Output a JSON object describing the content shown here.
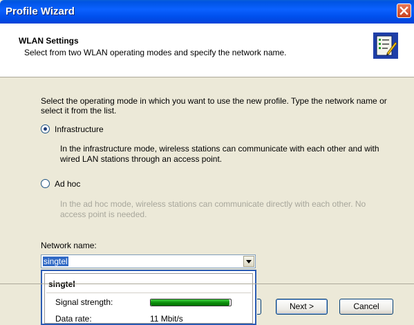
{
  "window": {
    "title": "Profile Wizard",
    "close_icon": "close-icon"
  },
  "header": {
    "title": "WLAN Settings",
    "subtitle": "Select from two WLAN operating modes and specify the network name.",
    "icon": "wizard-checklist-icon"
  },
  "intro": "Select the operating mode in which you want to use the new profile. Type the network name or select it from the list.",
  "modes": {
    "infrastructure": {
      "label": "Infrastructure",
      "selected": true,
      "description": "In the infrastructure mode, wireless stations can communicate with each other and with wired LAN stations through an access point."
    },
    "adhoc": {
      "label": "Ad hoc",
      "selected": false,
      "description": "In the ad hoc mode, wireless stations can communicate directly with each other. No access point is needed."
    }
  },
  "network": {
    "label": "Network name:",
    "value": "singtel"
  },
  "popup": {
    "name": "singtel",
    "signal_label": "Signal strength:",
    "signal_level": 0.98,
    "rate_label": "Data rate:",
    "rate_value": "11 Mbit/s"
  },
  "buttons": {
    "next": "Next >",
    "cancel": "Cancel"
  },
  "colors": {
    "titlebar": "#0b61ff",
    "selection": "#316ac5",
    "signal_bar": "#0a8c0a"
  }
}
